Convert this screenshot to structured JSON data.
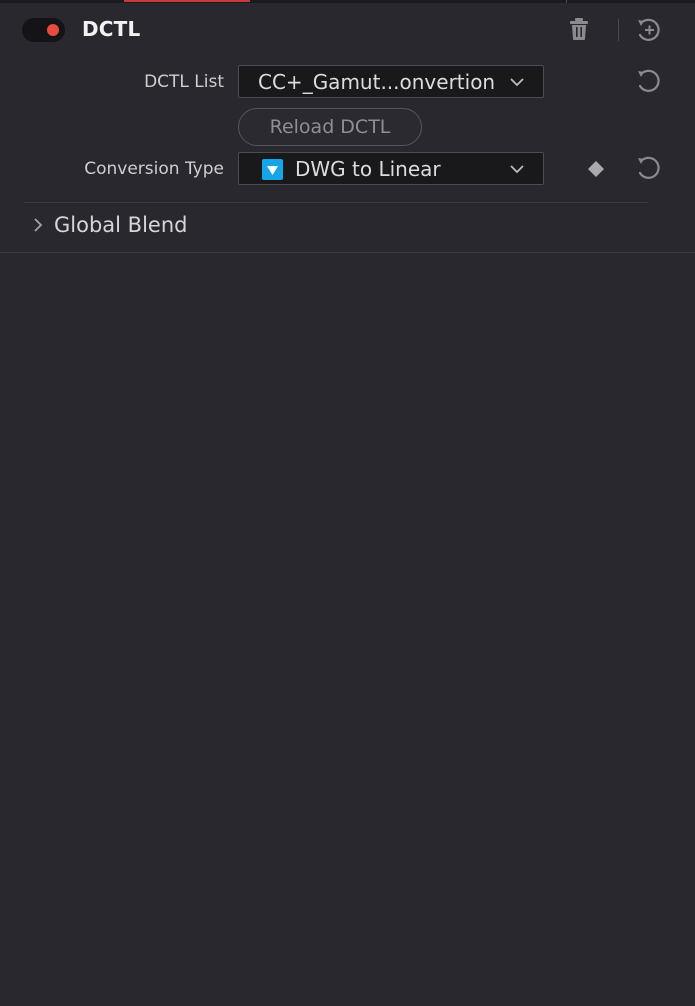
{
  "effect": {
    "title": "DCTL",
    "enabled": true,
    "accent_color": "#e84a3e"
  },
  "controls": {
    "dctl_list": {
      "label": "DCTL List",
      "value": "CC+_Gamut...onvertion"
    },
    "reload_button_label": "Reload DCTL",
    "conversion_type": {
      "label": "Conversion Type",
      "value": "DWG to Linear",
      "icon": "triangle-down-icon",
      "icon_color": "#16a6e8"
    }
  },
  "sections": {
    "global_blend": {
      "label": "Global Blend",
      "expanded": false
    }
  },
  "icons": {
    "trash": "trash-icon",
    "add": "add-circle-icon",
    "reset": "reset-icon",
    "keyframe": "keyframe-diamond-icon",
    "dropdown": "chevron-down-icon",
    "expand": "chevron-right-icon"
  }
}
